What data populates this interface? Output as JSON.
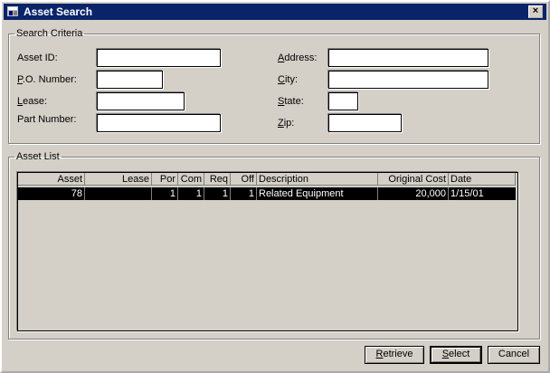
{
  "window": {
    "title": "Asset Search",
    "close_label": "×"
  },
  "criteria": {
    "legend": "Search Criteria",
    "asset_id": {
      "label": "Asset ID:",
      "value": ""
    },
    "po_number": {
      "label_pre": "",
      "label_u": "P",
      "label_post": ".O. Number:",
      "value": ""
    },
    "lease": {
      "label_pre": "",
      "label_u": "L",
      "label_post": "ease:",
      "value": ""
    },
    "part_number": {
      "label": "Part Number:",
      "value": ""
    },
    "address": {
      "label_pre": "",
      "label_u": "A",
      "label_post": "ddress:",
      "value": ""
    },
    "city": {
      "label_pre": "",
      "label_u": "C",
      "label_post": "ity:",
      "value": ""
    },
    "state": {
      "label_pre": "",
      "label_u": "S",
      "label_post": "tate:",
      "value": ""
    },
    "zip": {
      "label_pre": "",
      "label_u": "Z",
      "label_post": "ip:",
      "value": ""
    }
  },
  "asset_list": {
    "legend": "Asset List",
    "columns": [
      "Asset",
      "Lease",
      "Por",
      "Com",
      "Req",
      "Off",
      "Description",
      "Original Cost",
      "Date"
    ],
    "rows": [
      {
        "asset": "78",
        "lease": "",
        "por": "1",
        "com": "1",
        "req": "1",
        "off": "1",
        "description": "Related Equipment",
        "original_cost": "20,000",
        "date": "1/15/01"
      }
    ]
  },
  "buttons": {
    "retrieve_u": "R",
    "retrieve_rest": "etrieve",
    "select_u": "S",
    "select_rest": "elect",
    "cancel": "Cancel"
  }
}
